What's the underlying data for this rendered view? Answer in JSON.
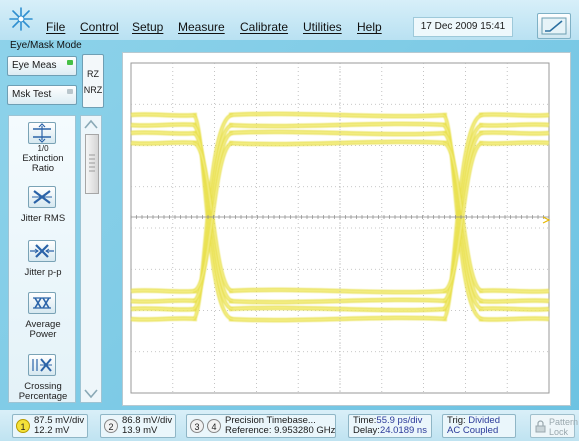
{
  "menu": {
    "items": [
      "File",
      "Control",
      "Setup",
      "Measure",
      "Calibrate",
      "Utilities",
      "Help"
    ],
    "datetime": "17 Dec 2009  15:41",
    "mode": "Eye/Mask Mode"
  },
  "left_panel": {
    "eye_meas": "Eye Meas",
    "mask_test": "Msk Test",
    "rz": "RZ",
    "nrz": "NRZ",
    "measurements": [
      {
        "line1": "Extinction",
        "line2": "Ratio",
        "icon_text": "1/0"
      },
      {
        "line1": "Jitter RMS",
        "line2": ""
      },
      {
        "line1": "Jitter p-p",
        "line2": ""
      },
      {
        "line1": "Average",
        "line2": "Power"
      },
      {
        "line1": "Crossing",
        "line2": "Percentage"
      }
    ]
  },
  "status": {
    "ch1": {
      "num": "1",
      "scale": "87.5 mV/div",
      "offset": "12.2 mV"
    },
    "ch2": {
      "num": "2",
      "scale": "86.8 mV/div",
      "offset": "13.9 mV"
    },
    "ch34": {
      "num3": "3",
      "num4": "4",
      "line1": "Precision Timebase...",
      "line2": "Reference: 9.953280 GHz"
    },
    "time": {
      "label1": "Time:",
      "value1": "55.9 ps/div",
      "label2": "Delay:",
      "value2": "24.0189 ns"
    },
    "trig": {
      "label": "Trig:",
      "value1": "Divided",
      "value2": "AC Coupled"
    },
    "lock": {
      "line1": "Pattern",
      "line2": "Lock"
    }
  },
  "colors": {
    "trace": "#e8df4a",
    "trace_core": "#f6f08a",
    "grid": "#9a9a9a",
    "marker": "#e6b800"
  }
}
